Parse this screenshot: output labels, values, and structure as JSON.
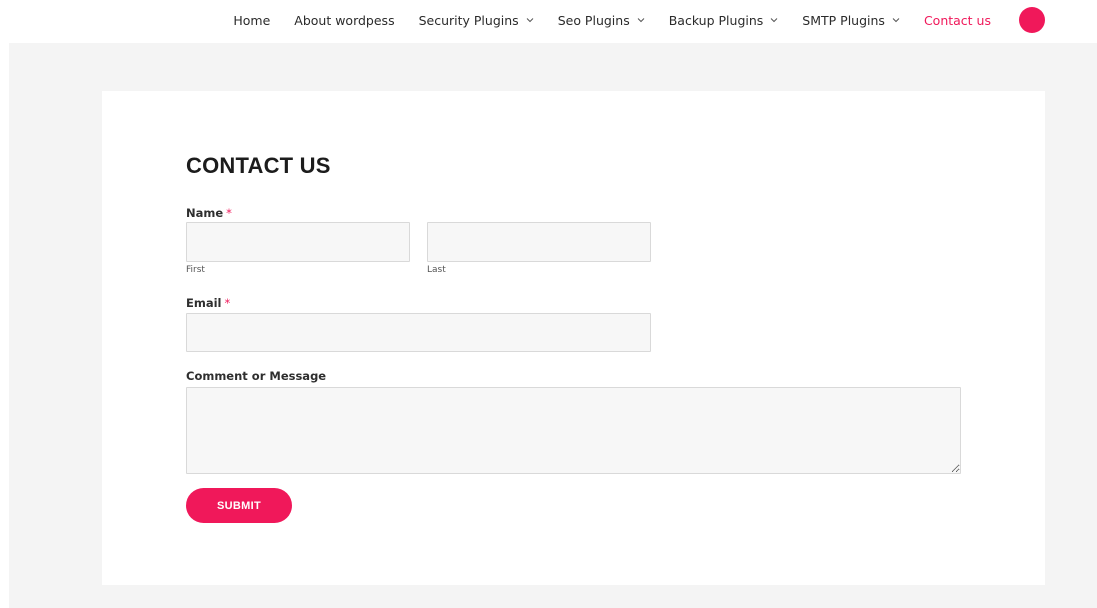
{
  "nav": {
    "items": [
      {
        "label": "Home",
        "has_dropdown": false
      },
      {
        "label": "About wordpess",
        "has_dropdown": false
      },
      {
        "label": "Security Plugins",
        "has_dropdown": true
      },
      {
        "label": "Seo Plugins",
        "has_dropdown": true
      },
      {
        "label": "Backup Plugins",
        "has_dropdown": true
      },
      {
        "label": "SMTP Plugins",
        "has_dropdown": true
      },
      {
        "label": "Contact us",
        "has_dropdown": false,
        "active": true
      }
    ],
    "accent_color": "#f0185a",
    "dot_icon": "circle-icon"
  },
  "page": {
    "title": "CONTACT US"
  },
  "form": {
    "name_label": "Name",
    "required_mark": "*",
    "first_sublabel": "First",
    "last_sublabel": "Last",
    "first_value": "",
    "last_value": "",
    "email_label": "Email",
    "email_value": "",
    "message_label": "Comment or Message",
    "message_value": "",
    "submit_label": "SUBMIT"
  },
  "colors": {
    "background": "#f4f4f4",
    "card": "#ffffff",
    "accent": "#f0185a"
  }
}
